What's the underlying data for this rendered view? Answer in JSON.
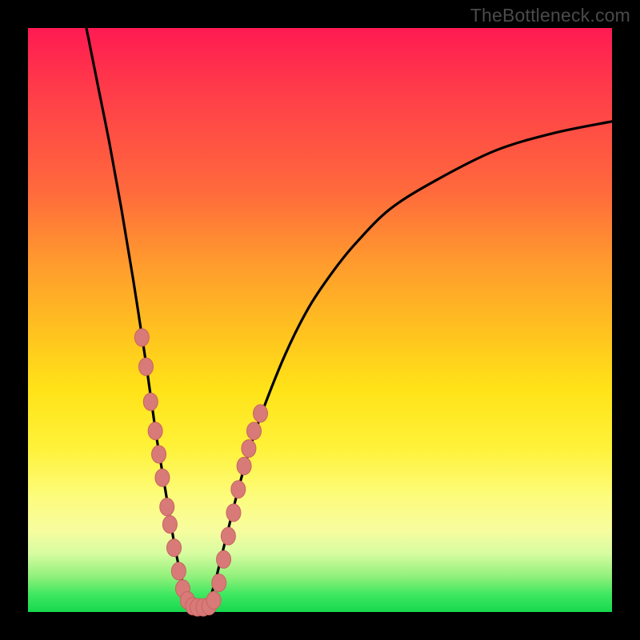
{
  "watermark": "TheBottleneck.com",
  "colors": {
    "background_frame": "#000000",
    "gradient_top": "#ff1a52",
    "gradient_mid1": "#ff9a2e",
    "gradient_mid2": "#ffe318",
    "gradient_bottom": "#17d84e",
    "curve": "#000000",
    "marker_fill": "#d87a78",
    "marker_stroke": "#c86460"
  },
  "chart_data": {
    "type": "line",
    "title": "",
    "xlabel": "",
    "ylabel": "",
    "xlim": [
      0,
      100
    ],
    "ylim": [
      0,
      100
    ],
    "note": "V-shaped bottleneck curve. Left branch: steep drop from top-left to minimum near x≈27. Right branch: rises with decreasing slope toward upper-right. Minimum (y≈0) around x≈25-31. Salmon markers cluster on both branches in the lower ~40% of the range and along the flat minimum.",
    "series": [
      {
        "name": "left-branch",
        "x": [
          10,
          12,
          14,
          16,
          18,
          20,
          21,
          22,
          23,
          24,
          25,
          26,
          27,
          28
        ],
        "y": [
          100,
          90,
          80,
          69,
          57,
          44,
          37,
          30,
          24,
          18,
          12,
          7,
          3,
          0
        ]
      },
      {
        "name": "right-branch",
        "x": [
          30,
          31,
          32,
          33,
          34,
          36,
          38,
          40,
          44,
          48,
          52,
          56,
          62,
          70,
          80,
          90,
          100
        ],
        "y": [
          0,
          2,
          5,
          9,
          13,
          21,
          28,
          34,
          44,
          52,
          58,
          63,
          69,
          74,
          79,
          82,
          84
        ]
      }
    ],
    "markers": [
      {
        "x": 19.5,
        "y": 47
      },
      {
        "x": 20.2,
        "y": 42
      },
      {
        "x": 21.0,
        "y": 36
      },
      {
        "x": 21.8,
        "y": 31
      },
      {
        "x": 22.4,
        "y": 27
      },
      {
        "x": 23.0,
        "y": 23
      },
      {
        "x": 23.8,
        "y": 18
      },
      {
        "x": 24.3,
        "y": 15
      },
      {
        "x": 25.0,
        "y": 11
      },
      {
        "x": 25.8,
        "y": 7
      },
      {
        "x": 26.5,
        "y": 4
      },
      {
        "x": 27.3,
        "y": 2
      },
      {
        "x": 28.2,
        "y": 1
      },
      {
        "x": 29.0,
        "y": 0.8
      },
      {
        "x": 30.0,
        "y": 0.8
      },
      {
        "x": 31.0,
        "y": 1
      },
      {
        "x": 31.8,
        "y": 2
      },
      {
        "x": 32.7,
        "y": 5
      },
      {
        "x": 33.5,
        "y": 9
      },
      {
        "x": 34.3,
        "y": 13
      },
      {
        "x": 35.2,
        "y": 17
      },
      {
        "x": 36.0,
        "y": 21
      },
      {
        "x": 37.0,
        "y": 25
      },
      {
        "x": 37.8,
        "y": 28
      },
      {
        "x": 38.7,
        "y": 31
      },
      {
        "x": 39.8,
        "y": 34
      }
    ]
  }
}
